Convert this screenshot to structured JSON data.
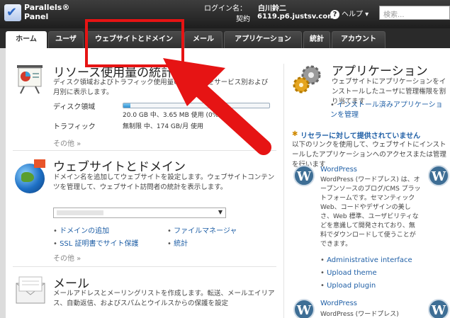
{
  "header": {
    "logo_line1": "Parallels®",
    "logo_line2": "Panel",
    "login_label": "ログイン名：",
    "login_name": "白川鈴二",
    "contract_label": "契約",
    "contract_value": "6119.p6.justsv.com",
    "help": "ヘルプ",
    "search_placeholder": "検索..."
  },
  "tabs": [
    "ホーム",
    "ユーザ",
    "ウェブサイトとドメイン",
    "メール",
    "アプリケーション",
    "統計",
    "アカウント"
  ],
  "resources": {
    "title": "リソース使用量の統計",
    "desc": "ディスク領域およびトラフィック使用量のレポートをサービス別および月別に表示します。",
    "disk_label": "ディスク領域",
    "disk_value": "20.0 GB 中、3.65 MB 使用 (0%)",
    "disk_fraction": 0.05,
    "traffic_label": "トラフィック",
    "traffic_value": "無制限 中、174 GB/月 使用",
    "more": "その他 »"
  },
  "websites": {
    "title": "ウェブサイトとドメイン",
    "desc": "ドメイン名を追加してウェブサイトを設定します。ウェブサイトコンテンツを管理して、ウェブサイト訪問者の統計を表示します。",
    "links": [
      "ドメインの追加",
      "ファイルマネージャ",
      "SSL 証明書でサイト保護",
      "統計"
    ],
    "more": "その他 »"
  },
  "mail": {
    "title": "メール",
    "desc": "メールアドレスとメーリングリストを作成します。転送、メールエイリアス、自動返信、およびスパムとウイルスからの保護を設定"
  },
  "applications": {
    "title": "アプリケーション",
    "desc": "ウェブサイトにアプリケーションをインストールしたユーザに管理権限を割り当てます",
    "link": "インストール済みアプリケーションを管理",
    "reseller": "リセラーに対して提供されていません",
    "reseller_desc": "以下のリンクを使用して、ウェブサイトにインストールしたアプリケーションへのアクセスまたは管理を行います",
    "wp_name": "WordPress",
    "wp_desc": "WordPress (ワードプレス) は、オープンソースのブログ/CMS プラットフォームです。セマンティック Web、コードやデザインの美しさ、Web 標準、ユーザビリティなどを意識して開発されており、無料でダウンロードして使うことができます。",
    "wp_links": [
      "Administrative interface",
      "Upload theme",
      "Upload plugin"
    ],
    "wp2_name": "WordPress",
    "wp2_desc": "WordPress (ワードプレス)"
  },
  "colors": {
    "highlight": "#e61414",
    "link": "#1f5fa6"
  }
}
